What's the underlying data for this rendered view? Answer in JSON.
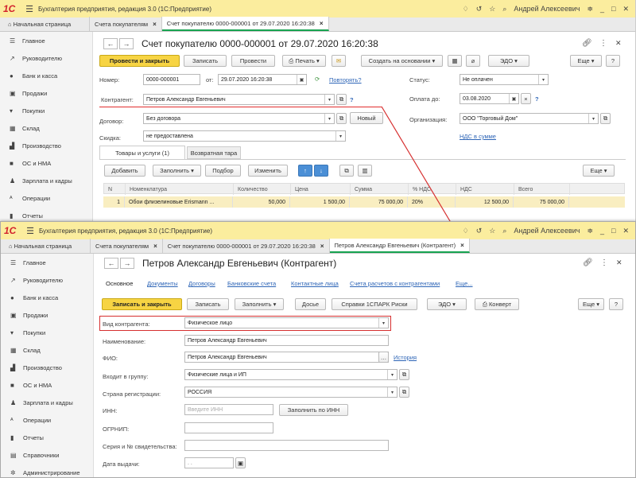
{
  "app": {
    "logo": "1С",
    "title": "Бухгалтерия предприятия, редакция 3.0  (1С:Предприятие)",
    "user": "Андрей Алексеевич"
  },
  "colors": {
    "titlebar": "#fbed9e",
    "accent_button": "#f7d443",
    "link": "#2f66b7",
    "highlight": "#d62f2f",
    "active_tab": "#17a350"
  },
  "sidebar": [
    {
      "icon": "menu-icon",
      "glyph": "☰",
      "label": "Главное"
    },
    {
      "icon": "chart-icon",
      "glyph": "↗",
      "label": "Руководителю"
    },
    {
      "icon": "bank-icon",
      "glyph": "●",
      "label": "Банк и касса"
    },
    {
      "icon": "bag-icon",
      "glyph": "▣",
      "label": "Продажи"
    },
    {
      "icon": "cart-icon",
      "glyph": "▾",
      "label": "Покупки"
    },
    {
      "icon": "warehouse-icon",
      "glyph": "▦",
      "label": "Склад"
    },
    {
      "icon": "factory-icon",
      "glyph": "▟",
      "label": "Производство"
    },
    {
      "icon": "truck-icon",
      "glyph": "■",
      "label": "ОС и НМА"
    },
    {
      "icon": "person-icon",
      "glyph": "♟",
      "label": "Зарплата и кадры"
    },
    {
      "icon": "operations-icon",
      "glyph": "ᴬ",
      "label": "Операции"
    },
    {
      "icon": "reports-icon",
      "glyph": "▮",
      "label": "Отчеты"
    },
    {
      "icon": "directory-icon",
      "glyph": "▤",
      "label": "Справочники"
    },
    {
      "icon": "admin-icon",
      "glyph": "✲",
      "label": "Администрирование"
    }
  ],
  "w1": {
    "tabs": {
      "home": "Начальная страница",
      "t1": "Счета покупателям",
      "t2": "Счет покупателю 0000-000001 от 29.07.2020 16:20:38"
    },
    "doc_title": "Счет покупателю 0000-000001 от 29.07.2020 16:20:38",
    "toolbar": {
      "post_close": "Провести и закрыть",
      "save": "Записать",
      "post": "Провести",
      "print": "Печать",
      "create_base": "Создать на основании",
      "edo": "ЭДО",
      "more": "Еще",
      "help": "?"
    },
    "form": {
      "number_label": "Номер:",
      "number": "0000-000001",
      "date_label": "от:",
      "date": "29.07.2020 16:20:38",
      "repeat": "Повторять?",
      "status_label": "Статус:",
      "status": "Не оплачен",
      "counterparty_label": "Контрагент:",
      "counterparty": "Петров Александр Евгеньевич",
      "q": "?",
      "pay_until_label": "Оплата до:",
      "pay_until": "03.08.2020",
      "contract_label": "Договор:",
      "contract": "Без договора",
      "new": "Новый",
      "org_label": "Организация:",
      "org": "ООО \"Торговый Дом\"",
      "discount_label": "Скидка:",
      "discount": "не предоставлена",
      "vat_link": "НДС в сумме"
    },
    "subtabs": {
      "goods": "Товары и услуги (1)",
      "returnable": "Возвратная тара"
    },
    "grid_toolbar": {
      "add": "Добавить",
      "fill": "Заполнить",
      "select": "Подбор",
      "change": "Изменить",
      "more": "Еще"
    },
    "grid": {
      "headers": [
        "N",
        "Номенклатура",
        "Количество",
        "Цена",
        "Сумма",
        "% НДС",
        "НДС",
        "Всего"
      ],
      "row": [
        "1",
        "Обои флизелиновые Erismann ...",
        "50,000",
        "1 500,00",
        "75 000,00",
        "20%",
        "12 500,00",
        "75 000,00"
      ]
    }
  },
  "w2": {
    "tabs": {
      "home": "Начальная страница",
      "t1": "Счета покупателям",
      "t2": "Счет покупателю 0000-000001 от 29.07.2020 16:20:38",
      "t3": "Петров Александр Евгеньевич (Контрагент)"
    },
    "doc_title": "Петров Александр Евгеньевич (Контрагент)",
    "links": {
      "main": "Основное",
      "docs": "Документы",
      "contracts": "Договоры",
      "bank": "Банковские счета",
      "contacts": "Контактные лица",
      "settlements": "Счета расчетов с контрагентами",
      "more": "Еще..."
    },
    "toolbar": {
      "save_close": "Записать и закрыть",
      "save": "Записать",
      "fill": "Заполнить",
      "dossier": "Досье",
      "spark": "Справки 1СПАРК Риски",
      "edo": "ЭДО",
      "envelope": "Конверт",
      "more": "Еще",
      "help": "?"
    },
    "form": {
      "kind_label": "Вид контрагента:",
      "kind": "Физическое лицо",
      "name_label": "Наименование:",
      "name": "Петров Александр Евгеньевич",
      "fio_label": "ФИО:",
      "fio": "Петров Александр Евгеньевич",
      "history": "История",
      "group_label": "Входит в группу:",
      "group": "Физические лица и ИП",
      "country_label": "Страна регистрации:",
      "country": "РОССИЯ",
      "inn_label": "ИНН:",
      "inn_placeholder": "Введите ИНН",
      "fill_inn": "Заполнить по ИНН",
      "ogrnip_label": "ОГРНИП:",
      "cert_label": "Серия и № свидетельства:",
      "issue_label": "Дата выдачи:",
      "issue_placeholder": " .  .   "
    }
  }
}
